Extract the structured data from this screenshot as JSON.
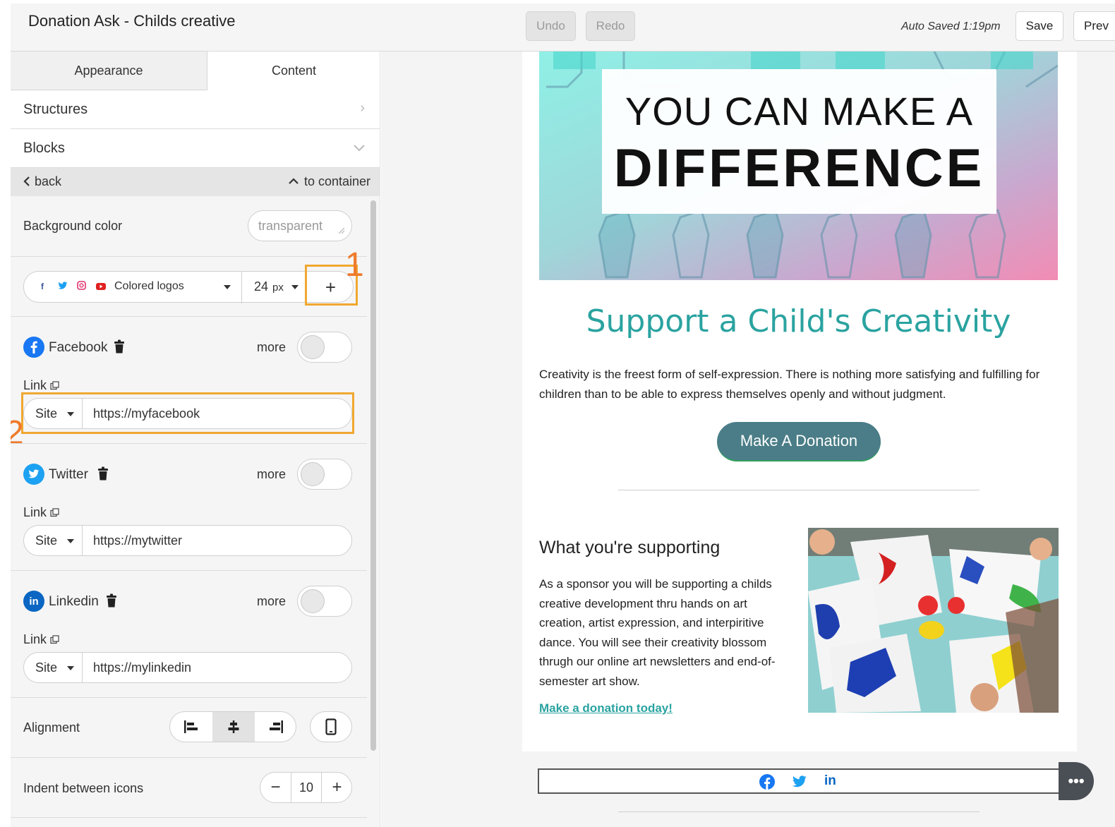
{
  "header": {
    "title": "Donation Ask - Childs creative",
    "undo_label": "Undo",
    "redo_label": "Redo",
    "auto_saved": "Auto Saved 1:19pm",
    "save_label": "Save",
    "preview_label": "Prev"
  },
  "panel": {
    "tabs": [
      {
        "label": "Appearance",
        "active": false
      },
      {
        "label": "Content",
        "active": true
      }
    ],
    "sections": {
      "structures": "Structures",
      "blocks": "Blocks"
    },
    "back_label": "back",
    "to_container_label": "to container",
    "background_color": {
      "label": "Background color",
      "value": "transparent"
    },
    "icon_style": {
      "label": "Colored logos",
      "size_value": "24",
      "size_unit": "px",
      "add_symbol": "+"
    },
    "networks": [
      {
        "name": "Facebook",
        "more": "more",
        "link_label": "Link",
        "type": "Site",
        "url": "https://myfacebook",
        "icon_color": "#1877f2",
        "glyph": "f"
      },
      {
        "name": "Twitter",
        "more": "more",
        "link_label": "Link",
        "type": "Site",
        "url": "https://mytwitter",
        "icon_color": "#1da1f2",
        "glyph": "t"
      },
      {
        "name": "Linkedin",
        "more": "more",
        "link_label": "Link",
        "type": "Site",
        "url": "https://mylinkedin",
        "icon_color": "#0a66c2",
        "glyph": "in"
      }
    ],
    "alignment_label": "Alignment",
    "alignment_selected": "center",
    "indent": {
      "label": "Indent between icons",
      "value": "10",
      "minus": "−",
      "plus": "+"
    },
    "annotations": [
      "1",
      "2"
    ]
  },
  "email": {
    "hero_line1": "YOU CAN MAKE A",
    "hero_line2": "DIFFERENCE",
    "headline": "Support a Child's Creativity",
    "intro": "Creativity is the freest form of self-expression. There is nothing more satisfying and fulfilling for children than to be able to express themselves openly and without judgment.",
    "donate_button": "Make A Donation",
    "support_title": "What you're supporting",
    "support_body": "As a sponsor you will be supporting a childs creative development thru hands on art creation, artist expression, and interpiritive dance. You will see their creativity blossom thrugh our online art newsletters and end-of-semester art show.",
    "donate_link": "Make a donation today!",
    "social_icons": [
      "facebook-icon",
      "twitter-icon",
      "linkedin-icon"
    ],
    "social_linkedin_text": "in",
    "more_actions": "•••"
  },
  "colors": {
    "accent_teal": "#2aa3a0",
    "button": "#4a7d87",
    "annotation": "#f0a830",
    "annotation_number": "#ee7a2b"
  }
}
